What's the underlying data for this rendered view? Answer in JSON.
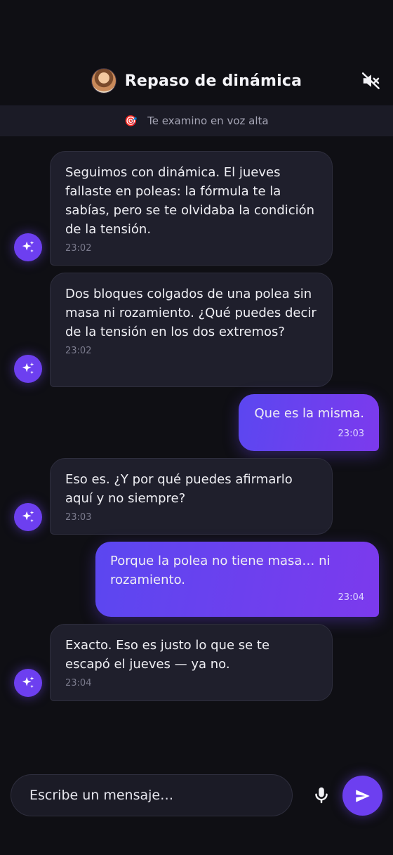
{
  "header": {
    "title": "Repaso de dinámica",
    "avatar_icon": "tutor-avatar",
    "mute_icon": "speaker-muted-icon"
  },
  "subbar": {
    "emoji": "🎯",
    "text": "Te examino en voz alta"
  },
  "messages": [
    {
      "role": "assistant",
      "text": "Seguimos con dinámica. El jueves fallaste en poleas: la fórmula te la sabías, pero se te olvidaba la condición de la tensión.",
      "time": "23:02"
    },
    {
      "role": "assistant",
      "text": "Dos bloques colgados de una polea sin masa ni rozamiento. ¿Qué puedes decir de la tensión en los dos extremos?",
      "time": "23:02"
    },
    {
      "role": "user",
      "text": "Que es la misma.",
      "time": "23:03"
    },
    {
      "role": "assistant",
      "text": "Eso es. ¿Y por qué puedes afirmarlo aquí y no siempre?",
      "time": "23:03"
    },
    {
      "role": "user",
      "text": "Porque la polea no tiene masa… ni rozamiento.",
      "time": "23:04"
    },
    {
      "role": "assistant",
      "text": "Exacto. Eso es justo lo que se te escapó el jueves — ya no.",
      "time": "23:04"
    }
  ],
  "composer": {
    "placeholder": "Escribe un mensaje…",
    "mic_icon": "microphone-icon",
    "send_icon": "send-icon"
  },
  "colors": {
    "background": "#0f0f14",
    "assistant_bubble": "#1f1f2c",
    "accent": "#6d3ff0",
    "user_gradient_start": "#5b47f0",
    "user_gradient_end": "#7c3aed"
  }
}
